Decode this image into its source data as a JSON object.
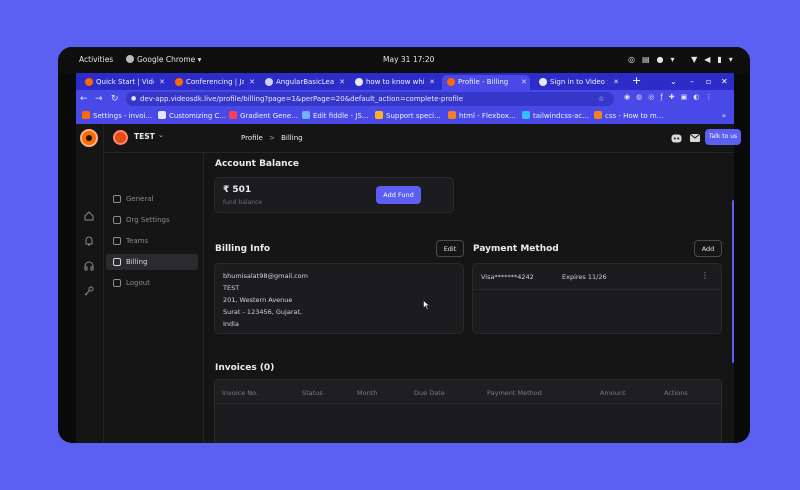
{
  "gnome": {
    "activities": "Activities",
    "app_name": "Google Chrome",
    "datetime": "May 31  17:20"
  },
  "tabs": [
    {
      "title": "Quick Start | Video",
      "color": "#ff6a00",
      "active": false
    },
    {
      "title": "Conferencing | Ja",
      "color": "#ff6a00",
      "active": false
    },
    {
      "title": "AngularBasicLear",
      "color": "#cfd2ff",
      "active": false
    },
    {
      "title": "how to know whi",
      "color": "#e8e8f0",
      "active": false
    },
    {
      "title": "Profile - Billing",
      "color": "#ff6a00",
      "active": true
    },
    {
      "title": "Sign in to Video S",
      "color": "#e8e8f0",
      "active": false
    }
  ],
  "browser": {
    "url": "dev-app.videosdk.live/profile/billing?page=1&perPage=20&default_action=complete-profile"
  },
  "bookmarks": [
    {
      "label": "Settings - invoi...",
      "color": "#ff6a00"
    },
    {
      "label": "Customizing C...",
      "color": "#e6e6ff"
    },
    {
      "label": "Gradient Gene...",
      "color": "#ff3b5c"
    },
    {
      "label": "Edit fiddle - JS...",
      "color": "#6fb3ff"
    },
    {
      "label": "Support speci...",
      "color": "#ffb020"
    },
    {
      "label": "html - Flexbox...",
      "color": "#f48024"
    },
    {
      "label": "tailwindcss-ac...",
      "color": "#38bdf8"
    },
    {
      "label": "css - How to m...",
      "color": "#f48024"
    }
  ],
  "app": {
    "org_name": "TEST",
    "breadcrumb": {
      "parent": "Profile",
      "separator": ">",
      "current": "Billing"
    },
    "talk_button": "Talk to us",
    "nav": [
      {
        "label": "General",
        "active": false
      },
      {
        "label": "Org Settings",
        "active": false
      },
      {
        "label": "Teams",
        "active": false
      },
      {
        "label": "Billing",
        "active": true
      },
      {
        "label": "Logout",
        "active": false
      }
    ],
    "account_balance": {
      "heading": "Account Balance",
      "amount": "₹ 501",
      "sublabel": "fund balance",
      "add_fund": "Add Fund"
    },
    "billing_info": {
      "heading": "Billing Info",
      "edit": "Edit",
      "lines": [
        "bhumisalat98@gmail.com",
        "TEST",
        "201, Western Avenue",
        "Surat - 123456, Gujarat,",
        "India"
      ]
    },
    "payment_method": {
      "heading": "Payment Method",
      "add": "Add",
      "card": "Visa*******4242",
      "expires": "Expires 11/26"
    },
    "invoices": {
      "heading": "Invoices (0)",
      "columns": [
        "Invoice No.",
        "Status",
        "Month",
        "Due Date",
        "Payment Method",
        "Amount",
        "Actions"
      ]
    }
  }
}
